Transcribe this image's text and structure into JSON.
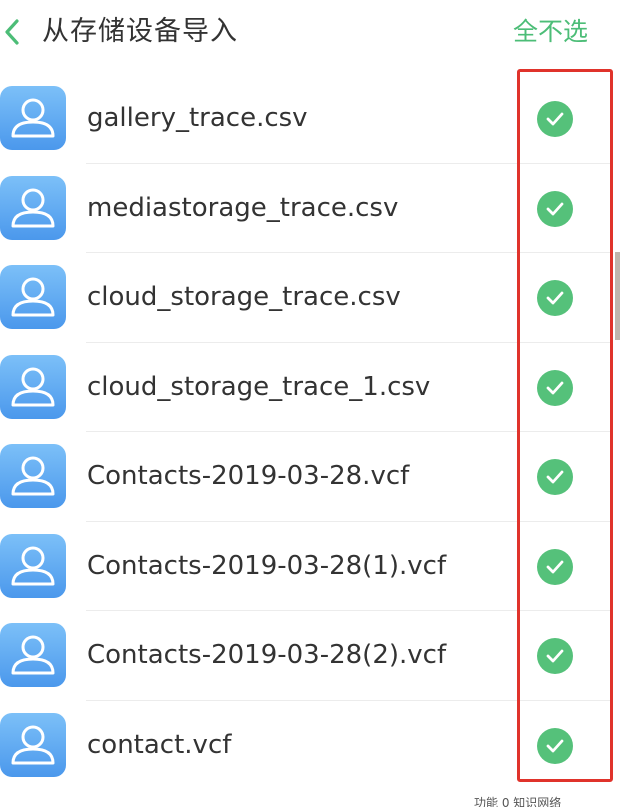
{
  "header": {
    "back_icon": "chevron-left-icon",
    "title": "从存储设备导入",
    "deselect_all_label": "全不选"
  },
  "files": [
    {
      "name": "gallery_trace.csv",
      "checked": true
    },
    {
      "name": "mediastorage_trace.csv",
      "checked": true
    },
    {
      "name": "cloud_storage_trace.csv",
      "checked": true
    },
    {
      "name": "cloud_storage_trace_1.csv",
      "checked": true
    },
    {
      "name": "Contacts-2019-03-28.vcf",
      "checked": true
    },
    {
      "name": "Contacts-2019-03-28(1).vcf",
      "checked": true
    },
    {
      "name": "Contacts-2019-03-28(2).vcf",
      "checked": true
    },
    {
      "name": "contact.vcf",
      "checked": true
    }
  ],
  "footer_hint": "功能 0 知识网络",
  "colors": {
    "accent_green": "#4cbd77",
    "check_green": "#55c17a",
    "avatar_blue": "#5ba8f0",
    "highlight_red": "#e0332b"
  },
  "icons": {
    "file_icon": "contact-avatar-icon",
    "check_icon": "checkmark-circle-icon"
  }
}
